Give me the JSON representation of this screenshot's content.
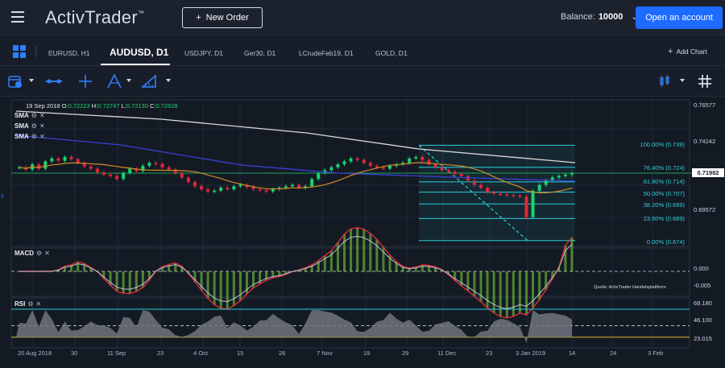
{
  "header": {
    "brand": "ActivTrader",
    "new_order_label": "New Order",
    "balance_label": "Balance:",
    "balance_value": "10000",
    "open_account_label": "Open an account"
  },
  "tabs": [
    {
      "label": "EURUSD, H1",
      "active": false
    },
    {
      "label": "AUDUSD, D1",
      "active": true
    },
    {
      "label": "USDJPY, D1",
      "active": false
    },
    {
      "label": "Ger30, D1",
      "active": false
    },
    {
      "label": "LCrudeFeb19, D1",
      "active": false
    },
    {
      "label": "GOLD, D1",
      "active": false
    }
  ],
  "add_chart_label": "Add Chart",
  "toolbar_icons": [
    "calendar-icon",
    "line-tool-icon",
    "crosshair-icon",
    "fibonacci-icon",
    "ruler-icon",
    "candle-type-icon",
    "grid-icon"
  ],
  "ohlc": {
    "date": "19 Sep 2018",
    "o_label": "O:",
    "o": "0.72223",
    "h_label": "H:",
    "h": "0.72747",
    "l_label": "L:",
    "l": "0.72130",
    "c_label": "C:",
    "c": "0.72628"
  },
  "indicators": {
    "sma": [
      "SMA",
      "SMA",
      "SMA"
    ],
    "macd": "MACD",
    "rsi": "RSI"
  },
  "price_axis": {
    "main": [
      "0.76577",
      "0.74242",
      "0.69572"
    ],
    "current": "0.71982",
    "macd": [
      "0.000",
      "-0.005"
    ],
    "rsi": [
      "69.180",
      "46.100",
      "23.015"
    ]
  },
  "fibonacci": [
    {
      "label": "100.00% (0.739)",
      "level": 0.739
    },
    {
      "label": "76.40% (0.724)",
      "level": 0.724
    },
    {
      "label": "61.80% (0.714)",
      "level": 0.714
    },
    {
      "label": "50.00% (0.707)",
      "level": 0.707
    },
    {
      "label": "38.20% (0.699)",
      "level": 0.699
    },
    {
      "label": "23.60% (0.689)",
      "level": 0.689
    },
    {
      "label": "0.00% (0.674)",
      "level": 0.674
    }
  ],
  "x_axis": [
    "20 Aug 2018",
    "30",
    "11 Sep",
    "23",
    "4 Oct",
    "15",
    "26",
    "7 Nov",
    "19",
    "29",
    "11 Dec",
    "23",
    "3 Jan 2019",
    "14",
    "24",
    "3 Feb"
  ],
  "source_note": "Quelle: ActivTrader Handelsplattform",
  "colors": {
    "accent": "#1e6bff",
    "bull": "#19d46b",
    "bear": "#e0283a",
    "fib": "#2ad0d8",
    "sma_fast": "#d08a2a",
    "sma_mid": "#3a3fd8",
    "sma_slow": "#d9d9d9"
  },
  "chart_data": {
    "type": "candlestick",
    "series": [
      {
        "name": "AUDUSD D1",
        "values": [
          0.724,
          0.7225,
          0.726,
          0.723,
          0.728,
          0.73,
          0.7285,
          0.731,
          0.7295,
          0.727,
          0.7245,
          0.723,
          0.7205,
          0.719,
          0.718,
          0.716,
          0.72,
          0.723,
          0.7215,
          0.725,
          0.727,
          0.7263,
          0.724,
          0.7225,
          0.72,
          0.717,
          0.714,
          0.711,
          0.709,
          0.7075,
          0.708,
          0.71,
          0.709,
          0.711,
          0.712,
          0.7105,
          0.709,
          0.7085,
          0.7075,
          0.709,
          0.71,
          0.711,
          0.712,
          0.71,
          0.711,
          0.716,
          0.72,
          0.722,
          0.724,
          0.726,
          0.728,
          0.73,
          0.729,
          0.727,
          0.725,
          0.724,
          0.723,
          0.725,
          0.726,
          0.727,
          0.73,
          0.731,
          0.729,
          0.726,
          0.724,
          0.722,
          0.721,
          0.7195,
          0.718,
          0.715,
          0.712,
          0.71,
          0.707,
          0.706,
          0.7055,
          0.705,
          0.7045,
          0.704,
          0.69,
          0.708,
          0.712,
          0.715,
          0.717,
          0.718,
          0.719,
          0.7198
        ]
      }
    ],
    "macd_range": [
      -0.0075,
      0.007
    ],
    "rsi_range": [
      15,
      85
    ],
    "price_range": [
      0.67,
      0.77
    ]
  }
}
